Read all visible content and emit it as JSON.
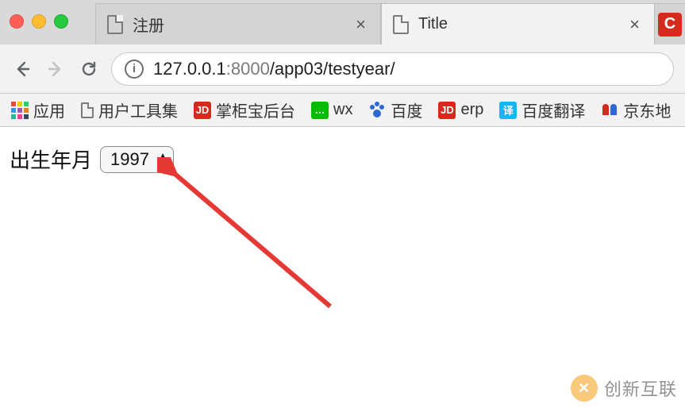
{
  "window": {
    "tabs": [
      {
        "title": "注册",
        "active": false
      },
      {
        "title": "Title",
        "active": true
      }
    ]
  },
  "nav": {
    "url_host": "127.0.0.1",
    "url_port": ":8000",
    "url_path": "/app03/testyear/",
    "info_badge": "i"
  },
  "bookmarks": {
    "apps": "应用",
    "items": [
      {
        "label": "用户工具集"
      },
      {
        "label": "掌柜宝后台"
      },
      {
        "label": "wx"
      },
      {
        "label": "百度"
      },
      {
        "label": "erp"
      },
      {
        "label": "百度翻译"
      },
      {
        "label": "京东地"
      }
    ]
  },
  "page": {
    "label": "出生年月",
    "year_value": "1997"
  },
  "watermark": {
    "text": "创新互联"
  }
}
